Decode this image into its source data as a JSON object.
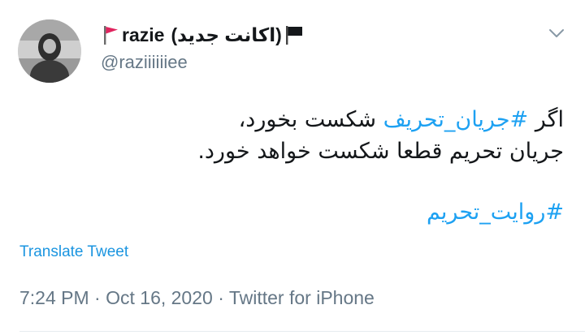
{
  "header": {
    "display_name_prefix": "razie",
    "display_name_suffix": "(اکانت جدید)",
    "handle": "@raziiiiiiee",
    "flag_left_color": "#e0245e",
    "flag_right_color": "#14171a"
  },
  "body": {
    "line1_before": "اگر ",
    "line1_hashtag": "#جریان_تحریف",
    "line1_after": " شکست بخورد،",
    "line2": "جریان تحریم قطعا شکست خواهد خورد.",
    "hashtag_final": "#روایت_تحریم"
  },
  "translate_label": "Translate Tweet",
  "meta": {
    "time": "7:24 PM",
    "date": "Oct 16, 2020",
    "source": "Twitter for iPhone",
    "separator": "·"
  },
  "icons": {
    "menu": "chevron-down-icon",
    "flag_red": "red-flag-icon",
    "flag_black": "black-flag-icon"
  },
  "colors": {
    "link": "#1da1f2",
    "muted": "#657786"
  }
}
